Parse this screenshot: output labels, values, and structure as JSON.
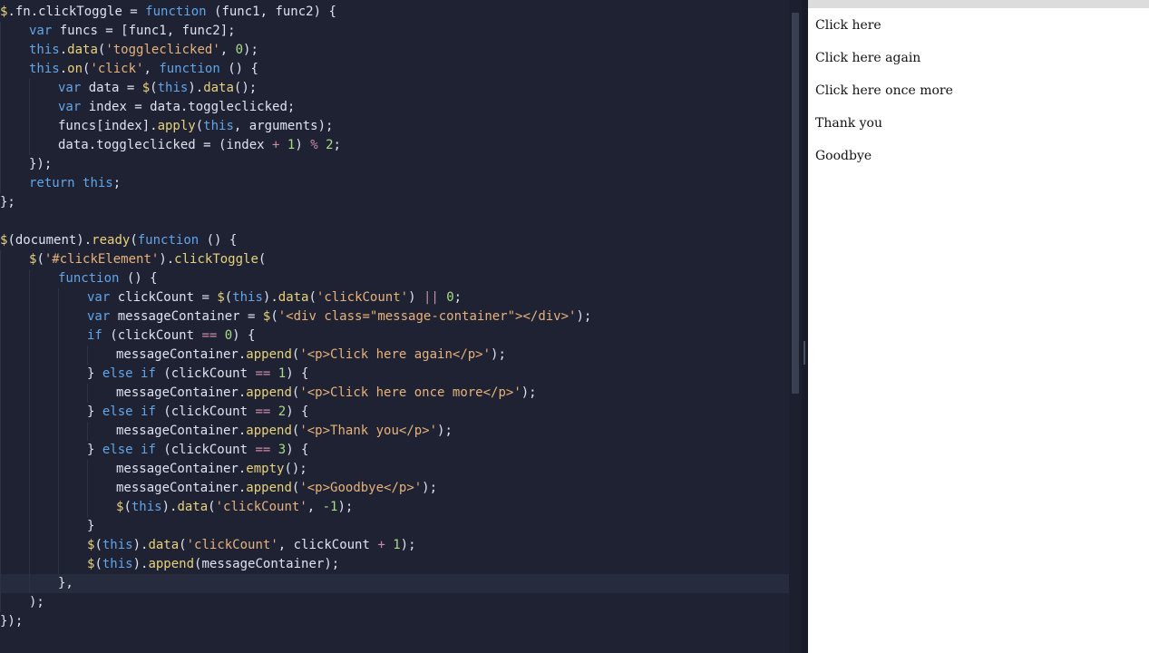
{
  "code_lines": [
    {
      "indent": 0,
      "tokens": [
        {
          "t": "$",
          "c": "fn"
        },
        {
          "t": ".fn.clickToggle = ",
          "c": "pl"
        },
        {
          "t": "function",
          "c": "kw"
        },
        {
          "t": " (func1, func2) {",
          "c": "pl"
        }
      ]
    },
    {
      "indent": 1,
      "tokens": [
        {
          "t": "var",
          "c": "kw"
        },
        {
          "t": " funcs = [func1, func2];",
          "c": "pl"
        }
      ]
    },
    {
      "indent": 1,
      "tokens": [
        {
          "t": "this",
          "c": "kw"
        },
        {
          "t": ".",
          "c": "pl"
        },
        {
          "t": "data",
          "c": "fn"
        },
        {
          "t": "(",
          "c": "pl"
        },
        {
          "t": "'toggleclicked'",
          "c": "str"
        },
        {
          "t": ", ",
          "c": "pl"
        },
        {
          "t": "0",
          "c": "num"
        },
        {
          "t": ");",
          "c": "pl"
        }
      ]
    },
    {
      "indent": 1,
      "tokens": [
        {
          "t": "this",
          "c": "kw"
        },
        {
          "t": ".",
          "c": "pl"
        },
        {
          "t": "on",
          "c": "fn"
        },
        {
          "t": "(",
          "c": "pl"
        },
        {
          "t": "'click'",
          "c": "str"
        },
        {
          "t": ", ",
          "c": "pl"
        },
        {
          "t": "function",
          "c": "kw"
        },
        {
          "t": " () {",
          "c": "pl"
        }
      ]
    },
    {
      "indent": 2,
      "tokens": [
        {
          "t": "var",
          "c": "kw"
        },
        {
          "t": " data = ",
          "c": "pl"
        },
        {
          "t": "$",
          "c": "fn"
        },
        {
          "t": "(",
          "c": "pl"
        },
        {
          "t": "this",
          "c": "kw"
        },
        {
          "t": ").",
          "c": "pl"
        },
        {
          "t": "data",
          "c": "fn"
        },
        {
          "t": "();",
          "c": "pl"
        }
      ]
    },
    {
      "indent": 2,
      "tokens": [
        {
          "t": "var",
          "c": "kw"
        },
        {
          "t": " index = data.toggleclicked;",
          "c": "pl"
        }
      ]
    },
    {
      "indent": 2,
      "tokens": [
        {
          "t": "funcs[index].",
          "c": "pl"
        },
        {
          "t": "apply",
          "c": "fn"
        },
        {
          "t": "(",
          "c": "pl"
        },
        {
          "t": "this",
          "c": "kw"
        },
        {
          "t": ", arguments);",
          "c": "pl"
        }
      ]
    },
    {
      "indent": 2,
      "tokens": [
        {
          "t": "data.toggleclicked = (index ",
          "c": "pl"
        },
        {
          "t": "+",
          "c": "op"
        },
        {
          "t": " ",
          "c": "pl"
        },
        {
          "t": "1",
          "c": "num"
        },
        {
          "t": ") ",
          "c": "pl"
        },
        {
          "t": "%",
          "c": "op"
        },
        {
          "t": " ",
          "c": "pl"
        },
        {
          "t": "2",
          "c": "num"
        },
        {
          "t": ";",
          "c": "pl"
        }
      ]
    },
    {
      "indent": 1,
      "tokens": [
        {
          "t": "});",
          "c": "pl"
        }
      ]
    },
    {
      "indent": 1,
      "tokens": [
        {
          "t": "return",
          "c": "kw"
        },
        {
          "t": " ",
          "c": "pl"
        },
        {
          "t": "this",
          "c": "kw"
        },
        {
          "t": ";",
          "c": "pl"
        }
      ]
    },
    {
      "indent": 0,
      "tokens": [
        {
          "t": "};",
          "c": "pl"
        }
      ]
    },
    {
      "indent": 0,
      "tokens": []
    },
    {
      "indent": 0,
      "tokens": [
        {
          "t": "$",
          "c": "fn"
        },
        {
          "t": "(document).",
          "c": "pl"
        },
        {
          "t": "ready",
          "c": "fn"
        },
        {
          "t": "(",
          "c": "pl"
        },
        {
          "t": "function",
          "c": "kw"
        },
        {
          "t": " () {",
          "c": "pl"
        }
      ]
    },
    {
      "indent": 1,
      "tokens": [
        {
          "t": "$",
          "c": "fn"
        },
        {
          "t": "(",
          "c": "pl"
        },
        {
          "t": "'#clickElement'",
          "c": "str"
        },
        {
          "t": ").",
          "c": "pl"
        },
        {
          "t": "clickToggle",
          "c": "fn"
        },
        {
          "t": "(",
          "c": "pl"
        }
      ]
    },
    {
      "indent": 2,
      "tokens": [
        {
          "t": "function",
          "c": "kw"
        },
        {
          "t": " () {",
          "c": "pl"
        }
      ]
    },
    {
      "indent": 3,
      "tokens": [
        {
          "t": "var",
          "c": "kw"
        },
        {
          "t": " clickCount = ",
          "c": "pl"
        },
        {
          "t": "$",
          "c": "fn"
        },
        {
          "t": "(",
          "c": "pl"
        },
        {
          "t": "this",
          "c": "kw"
        },
        {
          "t": ").",
          "c": "pl"
        },
        {
          "t": "data",
          "c": "fn"
        },
        {
          "t": "(",
          "c": "pl"
        },
        {
          "t": "'clickCount'",
          "c": "str"
        },
        {
          "t": ") ",
          "c": "pl"
        },
        {
          "t": "||",
          "c": "op"
        },
        {
          "t": " ",
          "c": "pl"
        },
        {
          "t": "0",
          "c": "num"
        },
        {
          "t": ";",
          "c": "pl"
        }
      ]
    },
    {
      "indent": 3,
      "tokens": [
        {
          "t": "var",
          "c": "kw"
        },
        {
          "t": " messageContainer = ",
          "c": "pl"
        },
        {
          "t": "$",
          "c": "fn"
        },
        {
          "t": "(",
          "c": "pl"
        },
        {
          "t": "'<div class=\"message-container\"></div>'",
          "c": "str"
        },
        {
          "t": ");",
          "c": "pl"
        }
      ]
    },
    {
      "indent": 3,
      "tokens": [
        {
          "t": "if",
          "c": "kw"
        },
        {
          "t": " (clickCount ",
          "c": "pl"
        },
        {
          "t": "==",
          "c": "op"
        },
        {
          "t": " ",
          "c": "pl"
        },
        {
          "t": "0",
          "c": "num"
        },
        {
          "t": ") {",
          "c": "pl"
        }
      ]
    },
    {
      "indent": 4,
      "tokens": [
        {
          "t": "messageContainer.",
          "c": "pl"
        },
        {
          "t": "append",
          "c": "fn"
        },
        {
          "t": "(",
          "c": "pl"
        },
        {
          "t": "'<p>Click here again</p>'",
          "c": "str"
        },
        {
          "t": ");",
          "c": "pl"
        }
      ]
    },
    {
      "indent": 3,
      "tokens": [
        {
          "t": "} ",
          "c": "pl"
        },
        {
          "t": "else",
          "c": "kw"
        },
        {
          "t": " ",
          "c": "pl"
        },
        {
          "t": "if",
          "c": "kw"
        },
        {
          "t": " (clickCount ",
          "c": "pl"
        },
        {
          "t": "==",
          "c": "op"
        },
        {
          "t": " ",
          "c": "pl"
        },
        {
          "t": "1",
          "c": "num"
        },
        {
          "t": ") {",
          "c": "pl"
        }
      ]
    },
    {
      "indent": 4,
      "tokens": [
        {
          "t": "messageContainer.",
          "c": "pl"
        },
        {
          "t": "append",
          "c": "fn"
        },
        {
          "t": "(",
          "c": "pl"
        },
        {
          "t": "'<p>Click here once more</p>'",
          "c": "str"
        },
        {
          "t": ");",
          "c": "pl"
        }
      ]
    },
    {
      "indent": 3,
      "tokens": [
        {
          "t": "} ",
          "c": "pl"
        },
        {
          "t": "else",
          "c": "kw"
        },
        {
          "t": " ",
          "c": "pl"
        },
        {
          "t": "if",
          "c": "kw"
        },
        {
          "t": " (clickCount ",
          "c": "pl"
        },
        {
          "t": "==",
          "c": "op"
        },
        {
          "t": " ",
          "c": "pl"
        },
        {
          "t": "2",
          "c": "num"
        },
        {
          "t": ") {",
          "c": "pl"
        }
      ]
    },
    {
      "indent": 4,
      "tokens": [
        {
          "t": "messageContainer.",
          "c": "pl"
        },
        {
          "t": "append",
          "c": "fn"
        },
        {
          "t": "(",
          "c": "pl"
        },
        {
          "t": "'<p>Thank you</p>'",
          "c": "str"
        },
        {
          "t": ");",
          "c": "pl"
        }
      ]
    },
    {
      "indent": 3,
      "tokens": [
        {
          "t": "} ",
          "c": "pl"
        },
        {
          "t": "else",
          "c": "kw"
        },
        {
          "t": " ",
          "c": "pl"
        },
        {
          "t": "if",
          "c": "kw"
        },
        {
          "t": " (clickCount ",
          "c": "pl"
        },
        {
          "t": "==",
          "c": "op"
        },
        {
          "t": " ",
          "c": "pl"
        },
        {
          "t": "3",
          "c": "num"
        },
        {
          "t": ") {",
          "c": "pl"
        }
      ]
    },
    {
      "indent": 4,
      "tokens": [
        {
          "t": "messageContainer.",
          "c": "pl"
        },
        {
          "t": "empty",
          "c": "fn"
        },
        {
          "t": "();",
          "c": "pl"
        }
      ]
    },
    {
      "indent": 4,
      "tokens": [
        {
          "t": "messageContainer.",
          "c": "pl"
        },
        {
          "t": "append",
          "c": "fn"
        },
        {
          "t": "(",
          "c": "pl"
        },
        {
          "t": "'<p>Goodbye</p>'",
          "c": "str"
        },
        {
          "t": ");",
          "c": "pl"
        }
      ]
    },
    {
      "indent": 4,
      "tokens": [
        {
          "t": "$",
          "c": "fn"
        },
        {
          "t": "(",
          "c": "pl"
        },
        {
          "t": "this",
          "c": "kw"
        },
        {
          "t": ").",
          "c": "pl"
        },
        {
          "t": "data",
          "c": "fn"
        },
        {
          "t": "(",
          "c": "pl"
        },
        {
          "t": "'clickCount'",
          "c": "str"
        },
        {
          "t": ", ",
          "c": "pl"
        },
        {
          "t": "-1",
          "c": "num"
        },
        {
          "t": ");",
          "c": "pl"
        }
      ]
    },
    {
      "indent": 3,
      "tokens": [
        {
          "t": "}",
          "c": "pl"
        }
      ]
    },
    {
      "indent": 3,
      "tokens": [
        {
          "t": "$",
          "c": "fn"
        },
        {
          "t": "(",
          "c": "pl"
        },
        {
          "t": "this",
          "c": "kw"
        },
        {
          "t": ").",
          "c": "pl"
        },
        {
          "t": "data",
          "c": "fn"
        },
        {
          "t": "(",
          "c": "pl"
        },
        {
          "t": "'clickCount'",
          "c": "str"
        },
        {
          "t": ", clickCount ",
          "c": "pl"
        },
        {
          "t": "+",
          "c": "op"
        },
        {
          "t": " ",
          "c": "pl"
        },
        {
          "t": "1",
          "c": "num"
        },
        {
          "t": ");",
          "c": "pl"
        }
      ]
    },
    {
      "indent": 3,
      "tokens": [
        {
          "t": "$",
          "c": "fn"
        },
        {
          "t": "(",
          "c": "pl"
        },
        {
          "t": "this",
          "c": "kw"
        },
        {
          "t": ").",
          "c": "pl"
        },
        {
          "t": "append",
          "c": "fn"
        },
        {
          "t": "(messageContainer);",
          "c": "pl"
        }
      ]
    },
    {
      "indent": 2,
      "tokens": [
        {
          "t": "},",
          "c": "pl"
        }
      ],
      "active": true
    },
    {
      "indent": 1,
      "tokens": [
        {
          "t": ");",
          "c": "pl"
        }
      ]
    },
    {
      "indent": 0,
      "tokens": [
        {
          "t": "});",
          "c": "pl"
        }
      ]
    }
  ],
  "preview": {
    "lines": [
      "Click here",
      "Click here again",
      "Click here once more",
      "Thank you",
      "Goodbye"
    ]
  },
  "theme": {
    "editor_bg": "#1e2233",
    "keyword": "#62a5e8",
    "function": "#e8d27a",
    "string": "#e8b27a",
    "number": "#a8dd86",
    "operator": "#cf8aa6"
  }
}
